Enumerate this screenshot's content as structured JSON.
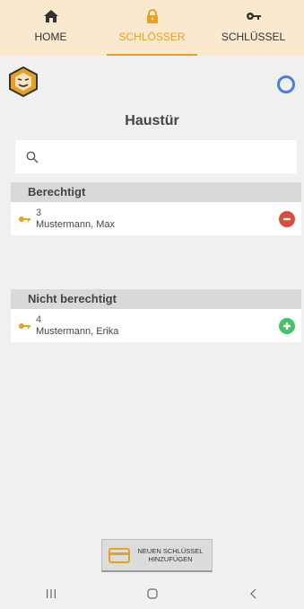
{
  "tabs": [
    {
      "label": "HOME",
      "icon": "home-icon"
    },
    {
      "label": "SCHLÖSSER",
      "icon": "lock-icon",
      "active": true
    },
    {
      "label": "SCHLÜSSEL",
      "icon": "key-icon"
    }
  ],
  "page": {
    "title": "Haustür"
  },
  "search": {
    "placeholder": ""
  },
  "sections": [
    {
      "header": "Berechtigt",
      "items": [
        {
          "number": "3",
          "name": "Mustermann, Max",
          "action": "remove"
        }
      ]
    },
    {
      "header": "Nicht berechtigt",
      "items": [
        {
          "number": "4",
          "name": "Mustermann, Erika",
          "action": "add"
        }
      ]
    }
  ],
  "new_key_button": {
    "line1": "NEUEN SCHLÜSSEL",
    "line2": "HINZUFÜGEN"
  },
  "colors": {
    "accent": "#e8a020",
    "tabbar": "#fae9cf",
    "remove": "#dc4b3c",
    "add": "#46c26b",
    "status_ring": "#4a7fe0"
  }
}
